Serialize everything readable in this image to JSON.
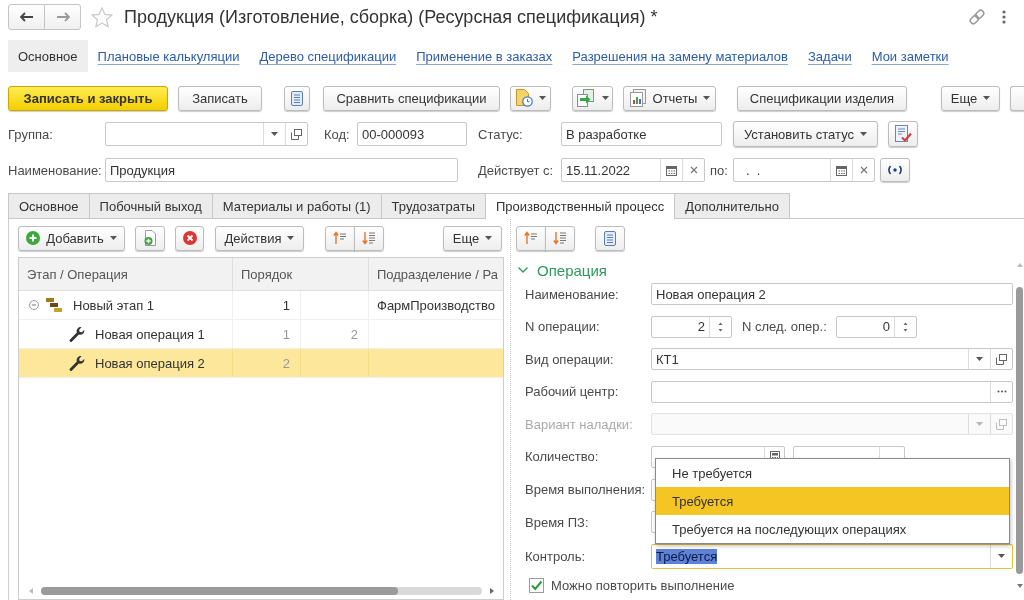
{
  "window": {
    "title": "Продукция (Изготовление, сборка) (Ресурсная спецификация) *"
  },
  "sections": [
    {
      "label": "Основное",
      "selected": true
    },
    {
      "label": "Плановые калькуляции",
      "selected": false
    },
    {
      "label": "Дерево спецификации",
      "selected": false
    },
    {
      "label": "Применение в заказах",
      "selected": false
    },
    {
      "label": "Разрешения на замену материалов",
      "selected": false
    },
    {
      "label": "Задачи",
      "selected": false
    },
    {
      "label": "Мои заметки",
      "selected": false
    }
  ],
  "toolbar": {
    "save_and_close": "Записать и закрыть",
    "save": "Записать",
    "compare": "Сравнить спецификации",
    "reports": "Отчеты",
    "product_specifications": "Спецификации изделия",
    "more": "Еще"
  },
  "header": {
    "group": {
      "label": "Группа:"
    },
    "code": {
      "label": "Код:",
      "value": "00-000093"
    },
    "status": {
      "label": "Статус:",
      "value": "В разработке"
    },
    "set_status": "Установить статус",
    "name": {
      "label": "Наименование:",
      "value": "Продукция"
    },
    "valid_from": {
      "label": "Действует с:",
      "value": "15.11.2022"
    },
    "valid_to": {
      "label": "по:",
      "value": ".  ."
    }
  },
  "tabs": [
    {
      "label": "Основное",
      "selected": false
    },
    {
      "label": "Побочный выход",
      "selected": false
    },
    {
      "label": "Материалы и работы (1)",
      "selected": false
    },
    {
      "label": "Трудозатраты",
      "selected": false
    },
    {
      "label": "Производственный процесс",
      "selected": true
    },
    {
      "label": "Дополнительно",
      "selected": false
    }
  ],
  "operations_panel": {
    "toolbar": {
      "add": "Добавить",
      "actions": "Действия",
      "more": "Еще"
    },
    "columns": [
      "Этап / Операция",
      "Порядок",
      "Подразделение / Ра"
    ],
    "rows": [
      {
        "kind": "stage",
        "name": "Новый этап 1",
        "order": "1",
        "department": "ФармПроизводство",
        "expanded": true,
        "selected": false,
        "children": [
          {
            "kind": "operation",
            "name": "Новая операция 1",
            "order": "1",
            "order_column_2": "2",
            "selected": false
          },
          {
            "kind": "operation",
            "name": "Новая операция 2",
            "order": "2",
            "selected": true
          }
        ]
      }
    ]
  },
  "operation_form": {
    "title": "Операция",
    "expanded": true,
    "fields": [
      {
        "kind": "text",
        "label": "Наименование:",
        "value": "Новая операция 2",
        "disabled": false,
        "focused": false
      },
      {
        "kind": "spin_pair",
        "label": "N операции:",
        "value": "2",
        "label_2": "N след. опер.:",
        "value_2": "0",
        "disabled": false,
        "focused": false
      },
      {
        "kind": "select",
        "label": "Вид операции:",
        "value": "КТ1",
        "disabled": false,
        "focused": false
      },
      {
        "kind": "choice",
        "label": "Рабочий центр:",
        "disabled": false,
        "focused": false
      },
      {
        "kind": "select",
        "label": "Вариант наладки:",
        "disabled": true,
        "focused": false
      },
      {
        "kind": "quantity",
        "label": "Количество:",
        "disabled": false,
        "focused": false
      },
      {
        "kind": "text",
        "label": "Время выполнения:",
        "disabled": false,
        "focused": false
      },
      {
        "kind": "text",
        "label": "Время ПЗ:",
        "disabled": false,
        "focused": false
      },
      {
        "kind": "dropdown",
        "label": "Контроль:",
        "value": "Требуется",
        "disabled": false,
        "focused": true
      }
    ],
    "checkbox": {
      "label": "Можно повторить выполнение",
      "checked": true
    },
    "dropdown_options": [
      {
        "label": "Не требуется",
        "selected": false
      },
      {
        "label": "Требуется",
        "selected": true
      },
      {
        "label": "Требуется на последующих операциях",
        "selected": false
      }
    ]
  }
}
